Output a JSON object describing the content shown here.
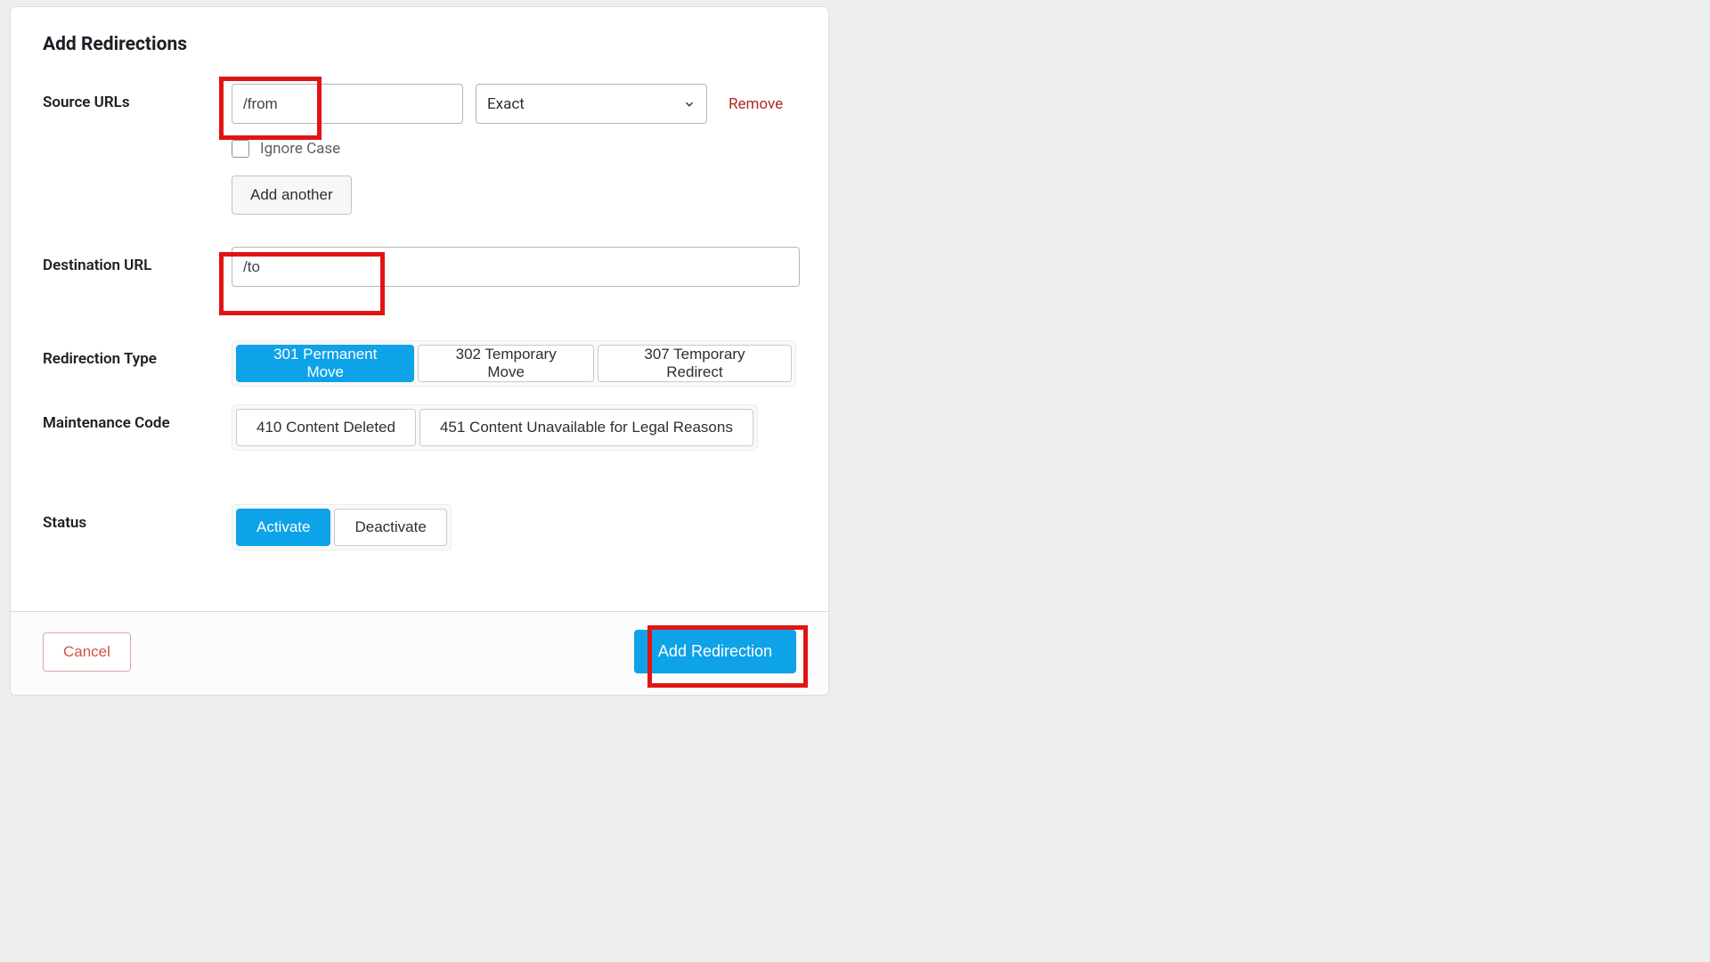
{
  "title": "Add Redirections",
  "labels": {
    "source": "Source URLs",
    "destination": "Destination URL",
    "redir_type": "Redirection Type",
    "maint_code": "Maintenance Code",
    "status": "Status"
  },
  "source": {
    "value": "/from",
    "match_selected": "Exact",
    "ignore_case_label": "Ignore Case",
    "add_another": "Add another",
    "remove": "Remove"
  },
  "destination": {
    "value": "/to"
  },
  "redir_type": {
    "options": [
      "301 Permanent Move",
      "302 Temporary Move",
      "307 Temporary Redirect"
    ],
    "active_index": 0
  },
  "maint_code": {
    "options": [
      "410 Content Deleted",
      "451 Content Unavailable for Legal Reasons"
    ],
    "active_index": -1
  },
  "status": {
    "options": [
      "Activate",
      "Deactivate"
    ],
    "active_index": 0
  },
  "footer": {
    "cancel": "Cancel",
    "submit": "Add Redirection"
  }
}
